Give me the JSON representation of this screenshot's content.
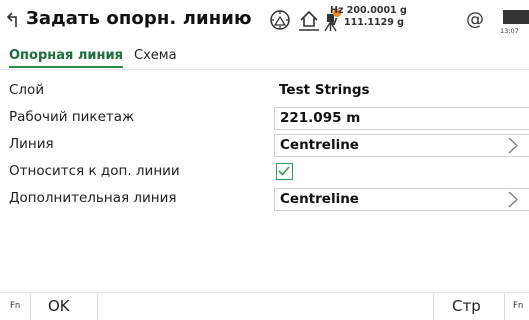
{
  "header": {
    "title": "Задать опорн. линию",
    "hz": "Hz 200.0001 g",
    "v": "V  111.1129 g",
    "at_symbol": "@",
    "time": "13:07"
  },
  "tabs": [
    {
      "label": "Опорная линия",
      "active": true
    },
    {
      "label": "Схема",
      "active": false
    }
  ],
  "form": {
    "layer": {
      "label": "Слой",
      "value": "Test Strings"
    },
    "working_chainage": {
      "label": "Рабочий пикетаж",
      "value": "221.095 m"
    },
    "line": {
      "label": "Линия",
      "value": "Centreline"
    },
    "related_to_extra_line": {
      "label": "Относится к доп. линии",
      "checked": true
    },
    "extra_line": {
      "label": "Дополнительная линия",
      "value": "Centreline"
    }
  },
  "softkeys": {
    "fn_left": "Fn",
    "ok": "OK",
    "page": "Стр",
    "fn_right": "Fn"
  },
  "colors": {
    "accent_green": "#2e8b46",
    "active_tab_text": "#1b6f3a"
  },
  "icons": {
    "back": "back-arrow-icon",
    "prism": "prism-target-icon",
    "home": "home-icon",
    "instrument": "instrument-status-icon",
    "at": "at-icon",
    "battery": "battery-icon",
    "chevron": "chevron-right-icon",
    "check": "checkmark-icon"
  }
}
